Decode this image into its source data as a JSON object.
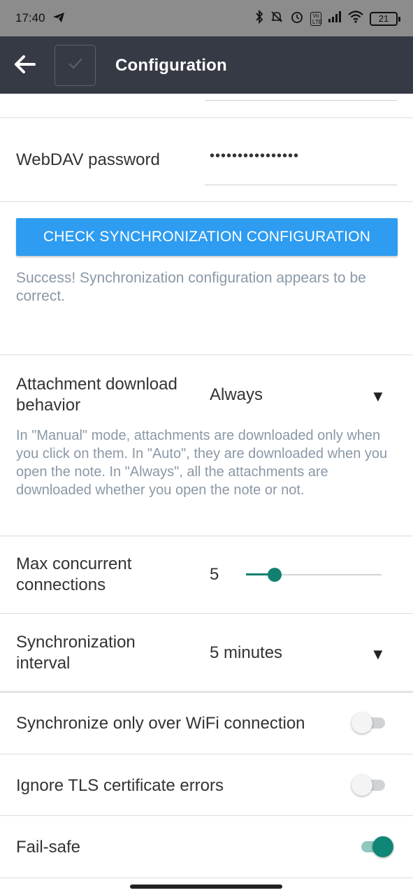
{
  "status_bar": {
    "time": "17:40",
    "battery": "21"
  },
  "app_bar": {
    "title": "Configuration",
    "back_icon": "arrow-left-icon",
    "check_icon": "checkmark-icon"
  },
  "password": {
    "label": "WebDAV password",
    "value": "••••••••••••••••"
  },
  "check_sync": {
    "button_label": "CHECK SYNCHRONIZATION CONFIGURATION",
    "result": "Success! Synchronization configuration appears to be correct."
  },
  "attachment": {
    "label": "Attachment download behavior",
    "value": "Always",
    "description": "In \"Manual\" mode, attachments are downloaded only when you click on them. In \"Auto\", they are downloaded when you open the note. In \"Always\", all the attachments are downloaded whether you open the note or not."
  },
  "connections": {
    "label": "Max concurrent connections",
    "value": "5",
    "slider_fraction": 0.21
  },
  "interval": {
    "label": "Synchronization interval",
    "value": "5 minutes"
  },
  "wifi_only": {
    "label": "Synchronize only over WiFi connection",
    "enabled": false
  },
  "ignore_tls": {
    "label": "Ignore TLS certificate errors",
    "enabled": false
  },
  "fail_safe": {
    "label": "Fail-safe",
    "enabled": true
  },
  "colors": {
    "app_bar": "#363a45",
    "button": "#2e9cf0",
    "accent": "#11806f",
    "description_text": "#8a98a6"
  }
}
